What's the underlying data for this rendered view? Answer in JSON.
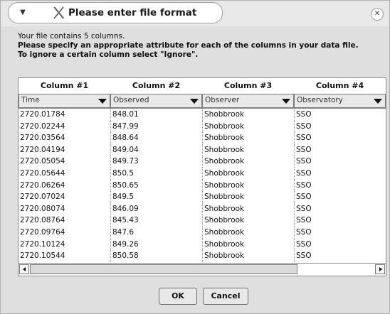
{
  "window": {
    "title": "Please enter file format",
    "menu_icon": "chevron-down-icon",
    "title_icon": "x-logo-icon",
    "close_icon": "close-icon"
  },
  "intro": {
    "line1": "Your file contains 5 columns.",
    "line2": "Please specify an appropriate attribute for each of the columns in your data file.",
    "line3": "To ignore a certain column select \"Ignore\"."
  },
  "table": {
    "column_headers": [
      "Column #1",
      "Column #2",
      "Column #3",
      "Column #4"
    ],
    "attributes": [
      "Time",
      "Observed",
      "Observer",
      "Observatory"
    ],
    "rows": [
      [
        "2720.01784",
        "848.01",
        "Shobbrook",
        "SSO"
      ],
      [
        "2720.02244",
        "847.99",
        "Shobbrook",
        "SSO"
      ],
      [
        "2720.03564",
        "848.64",
        "Shobbrook",
        "SSO"
      ],
      [
        "2720.04194",
        "849.04",
        "Shobbrook",
        "SSO"
      ],
      [
        "2720.05054",
        "849.73",
        "Shobbrook",
        "SSO"
      ],
      [
        "2720.05644",
        "850.5",
        "Shobbrook",
        "SSO"
      ],
      [
        "2720.06264",
        "850.65",
        "Shobbrook",
        "SSO"
      ],
      [
        "2720.07024",
        "849.5",
        "Shobbrook",
        "SSO"
      ],
      [
        "2720.08074",
        "846.09",
        "Shobbrook",
        "SSO"
      ],
      [
        "2720.08764",
        "845.43",
        "Shobbrook",
        "SSO"
      ],
      [
        "2720.09764",
        "847.6",
        "Shobbrook",
        "SSO"
      ],
      [
        "2720.10124",
        "849.26",
        "Shobbrook",
        "SSO"
      ],
      [
        "2720.10544",
        "850.58",
        "Shobbrook",
        "SSO"
      ]
    ]
  },
  "buttons": {
    "ok_label": "OK",
    "cancel_label": "Cancel"
  }
}
